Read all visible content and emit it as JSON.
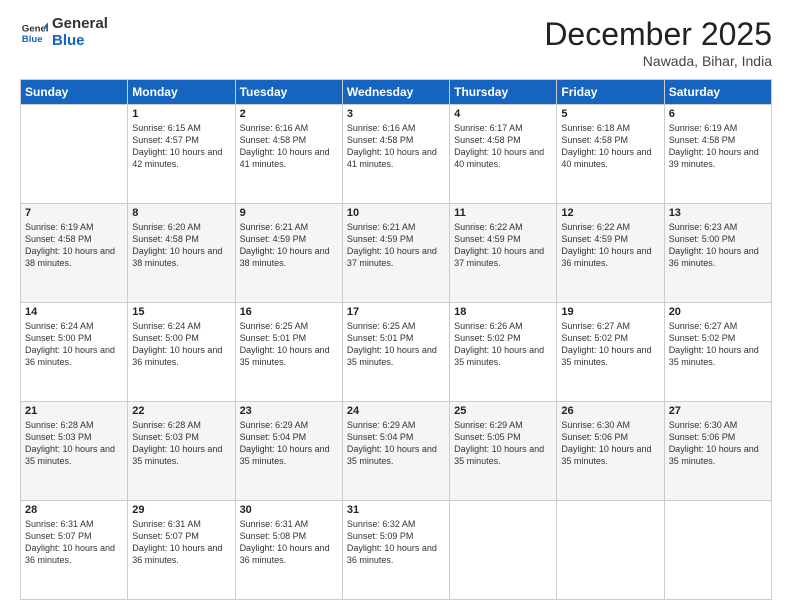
{
  "header": {
    "logo_line1": "General",
    "logo_line2": "Blue",
    "month_title": "December 2025",
    "location": "Nawada, Bihar, India"
  },
  "weekdays": [
    "Sunday",
    "Monday",
    "Tuesday",
    "Wednesday",
    "Thursday",
    "Friday",
    "Saturday"
  ],
  "weeks": [
    [
      {
        "day": "",
        "sunrise": "",
        "sunset": "",
        "daylight": ""
      },
      {
        "day": "1",
        "sunrise": "6:15 AM",
        "sunset": "4:57 PM",
        "daylight": "10 hours and 42 minutes."
      },
      {
        "day": "2",
        "sunrise": "6:16 AM",
        "sunset": "4:58 PM",
        "daylight": "10 hours and 41 minutes."
      },
      {
        "day": "3",
        "sunrise": "6:16 AM",
        "sunset": "4:58 PM",
        "daylight": "10 hours and 41 minutes."
      },
      {
        "day": "4",
        "sunrise": "6:17 AM",
        "sunset": "4:58 PM",
        "daylight": "10 hours and 40 minutes."
      },
      {
        "day": "5",
        "sunrise": "6:18 AM",
        "sunset": "4:58 PM",
        "daylight": "10 hours and 40 minutes."
      },
      {
        "day": "6",
        "sunrise": "6:19 AM",
        "sunset": "4:58 PM",
        "daylight": "10 hours and 39 minutes."
      }
    ],
    [
      {
        "day": "7",
        "sunrise": "6:19 AM",
        "sunset": "4:58 PM",
        "daylight": "10 hours and 38 minutes."
      },
      {
        "day": "8",
        "sunrise": "6:20 AM",
        "sunset": "4:58 PM",
        "daylight": "10 hours and 38 minutes."
      },
      {
        "day": "9",
        "sunrise": "6:21 AM",
        "sunset": "4:59 PM",
        "daylight": "10 hours and 38 minutes."
      },
      {
        "day": "10",
        "sunrise": "6:21 AM",
        "sunset": "4:59 PM",
        "daylight": "10 hours and 37 minutes."
      },
      {
        "day": "11",
        "sunrise": "6:22 AM",
        "sunset": "4:59 PM",
        "daylight": "10 hours and 37 minutes."
      },
      {
        "day": "12",
        "sunrise": "6:22 AM",
        "sunset": "4:59 PM",
        "daylight": "10 hours and 36 minutes."
      },
      {
        "day": "13",
        "sunrise": "6:23 AM",
        "sunset": "5:00 PM",
        "daylight": "10 hours and 36 minutes."
      }
    ],
    [
      {
        "day": "14",
        "sunrise": "6:24 AM",
        "sunset": "5:00 PM",
        "daylight": "10 hours and 36 minutes."
      },
      {
        "day": "15",
        "sunrise": "6:24 AM",
        "sunset": "5:00 PM",
        "daylight": "10 hours and 36 minutes."
      },
      {
        "day": "16",
        "sunrise": "6:25 AM",
        "sunset": "5:01 PM",
        "daylight": "10 hours and 35 minutes."
      },
      {
        "day": "17",
        "sunrise": "6:25 AM",
        "sunset": "5:01 PM",
        "daylight": "10 hours and 35 minutes."
      },
      {
        "day": "18",
        "sunrise": "6:26 AM",
        "sunset": "5:02 PM",
        "daylight": "10 hours and 35 minutes."
      },
      {
        "day": "19",
        "sunrise": "6:27 AM",
        "sunset": "5:02 PM",
        "daylight": "10 hours and 35 minutes."
      },
      {
        "day": "20",
        "sunrise": "6:27 AM",
        "sunset": "5:02 PM",
        "daylight": "10 hours and 35 minutes."
      }
    ],
    [
      {
        "day": "21",
        "sunrise": "6:28 AM",
        "sunset": "5:03 PM",
        "daylight": "10 hours and 35 minutes."
      },
      {
        "day": "22",
        "sunrise": "6:28 AM",
        "sunset": "5:03 PM",
        "daylight": "10 hours and 35 minutes."
      },
      {
        "day": "23",
        "sunrise": "6:29 AM",
        "sunset": "5:04 PM",
        "daylight": "10 hours and 35 minutes."
      },
      {
        "day": "24",
        "sunrise": "6:29 AM",
        "sunset": "5:04 PM",
        "daylight": "10 hours and 35 minutes."
      },
      {
        "day": "25",
        "sunrise": "6:29 AM",
        "sunset": "5:05 PM",
        "daylight": "10 hours and 35 minutes."
      },
      {
        "day": "26",
        "sunrise": "6:30 AM",
        "sunset": "5:06 PM",
        "daylight": "10 hours and 35 minutes."
      },
      {
        "day": "27",
        "sunrise": "6:30 AM",
        "sunset": "5:06 PM",
        "daylight": "10 hours and 35 minutes."
      }
    ],
    [
      {
        "day": "28",
        "sunrise": "6:31 AM",
        "sunset": "5:07 PM",
        "daylight": "10 hours and 36 minutes."
      },
      {
        "day": "29",
        "sunrise": "6:31 AM",
        "sunset": "5:07 PM",
        "daylight": "10 hours and 36 minutes."
      },
      {
        "day": "30",
        "sunrise": "6:31 AM",
        "sunset": "5:08 PM",
        "daylight": "10 hours and 36 minutes."
      },
      {
        "day": "31",
        "sunrise": "6:32 AM",
        "sunset": "5:09 PM",
        "daylight": "10 hours and 36 minutes."
      },
      {
        "day": "",
        "sunrise": "",
        "sunset": "",
        "daylight": ""
      },
      {
        "day": "",
        "sunrise": "",
        "sunset": "",
        "daylight": ""
      },
      {
        "day": "",
        "sunrise": "",
        "sunset": "",
        "daylight": ""
      }
    ]
  ],
  "labels": {
    "sunrise_prefix": "Sunrise: ",
    "sunset_prefix": "Sunset: ",
    "daylight_prefix": "Daylight: "
  }
}
